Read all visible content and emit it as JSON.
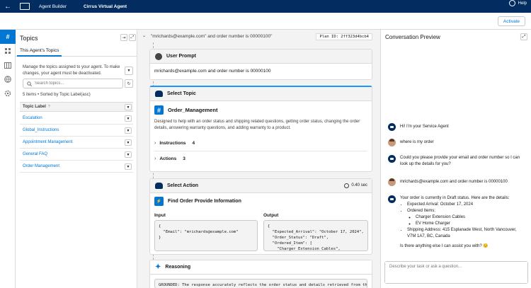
{
  "topbar": {
    "back_glyph": "←",
    "app_title": "Agent Builder",
    "record_title": "Cirrus Virtual Agent",
    "help_label": "Help"
  },
  "actionbar": {
    "activate_label": "Activate"
  },
  "rail": {
    "items": [
      "hash-icon",
      "apps-icon",
      "library-icon",
      "globe-icon",
      "settings-icon"
    ]
  },
  "topics_panel": {
    "title": "Topics",
    "tab_label": "This Agent's Topics",
    "description": "Manage the topics assigned to your agent. To make changes, your agent must be deactivated.",
    "search_placeholder": "Search topics...",
    "items_count": "5 items • Sorted by Topic Label(asc)",
    "column_header": "Topic Label",
    "rows": [
      "Escalation",
      "Global_Instructions",
      "Appointment Management",
      "General FAQ",
      "Order Management"
    ]
  },
  "trace": {
    "query": "\"mrichards@example.com\" and order number is 00000100\"",
    "plan_id": "Plan ID: 2ff323d4bcb4",
    "user_prompt": {
      "title": "User Prompt",
      "text": "mrichards@example.com and order number is 00000100"
    },
    "select_topic": {
      "title": "Select Topic",
      "topic_name": "Order_Management",
      "description": "Designed to help with an order status and shipping related questions, getting order status, changing the order details, answering warranty questions, and adding warranty to a product.",
      "instructions_label": "Instructions",
      "instructions_count": "4",
      "actions_label": "Actions",
      "actions_count": "3"
    },
    "select_action": {
      "title": "Select Action",
      "duration": "0.40 sec",
      "action_name": "Find Order Provide Information",
      "input_label": "Input",
      "output_label": "Output",
      "input_code": "{\n  \"Email\": \"mrichards@example.com\"\n}",
      "output_code": "{\n  \"Expected_Arrival\": \"October 17, 2024\",\n  \"Order_Status\": \"Draft\",\n  \"Ordered_Item\": [\n    \"Charger Extension Cables\",\n    \"EV Home Charger\""
    },
    "reasoning": {
      "title": "Reasoning",
      "text": "GROUNDED: The response accurately reflects the order status and details retrieved from the"
    }
  },
  "conversation": {
    "title": "Conversation Preview",
    "messages": {
      "bot_greeting": "Hi! I'm your Service Agent",
      "user_1": "where is my order",
      "bot_ask": "Could you please provide your email and order number so I can look up the details for you?",
      "user_2": "mrichards@example.com and order number is 00000100",
      "bot_status_intro": "Your order is currently in Draft status. Here are the details:",
      "expected_arrival": "Expected Arrival: October 17, 2024",
      "ordered_items": "Ordered Items:",
      "item_1": "Charger Extension Cables",
      "item_2": "EV Home Charger",
      "shipping": "Shipping Address: 415 Esplanade West, North Vancouver, V7M 1A7, BC, Canada",
      "closing": "Is there anything else I can assist you with? 😊"
    },
    "composer_placeholder": "Describe your task or ask a question..."
  }
}
